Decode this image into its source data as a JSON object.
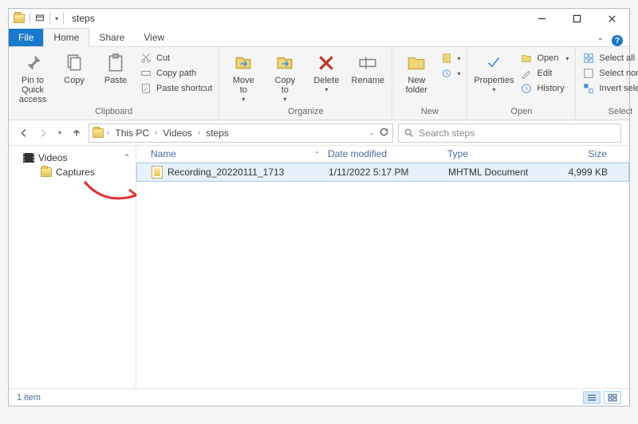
{
  "window": {
    "title": "steps"
  },
  "tabs": {
    "file": "File",
    "home": "Home",
    "share": "Share",
    "view": "View"
  },
  "ribbon": {
    "clipboard": {
      "label": "Clipboard",
      "pin": "Pin to Quick\naccess",
      "copy": "Copy",
      "paste": "Paste",
      "cut": "Cut",
      "copypath": "Copy path",
      "shortcut": "Paste shortcut"
    },
    "organize": {
      "label": "Organize",
      "moveto": "Move\nto",
      "copyto": "Copy\nto",
      "delete": "Delete",
      "rename": "Rename"
    },
    "new": {
      "label": "New",
      "newfolder": "New\nfolder"
    },
    "open": {
      "label": "Open",
      "properties": "Properties",
      "open": "Open",
      "edit": "Edit",
      "history": "History"
    },
    "select": {
      "label": "Select",
      "all": "Select all",
      "none": "Select none",
      "invert": "Invert selection"
    }
  },
  "breadcrumb": {
    "pc": "This PC",
    "videos": "Videos",
    "steps": "steps"
  },
  "search": {
    "placeholder": "Search steps"
  },
  "tree": {
    "videos": "Videos",
    "captures": "Captures"
  },
  "columns": {
    "name": "Name",
    "date": "Date modified",
    "type": "Type",
    "size": "Size"
  },
  "files": [
    {
      "name": "Recording_20220111_1713",
      "date": "1/11/2022 5:17 PM",
      "type": "MHTML Document",
      "size": "4,999 KB"
    }
  ],
  "status": {
    "count": "1 item"
  }
}
